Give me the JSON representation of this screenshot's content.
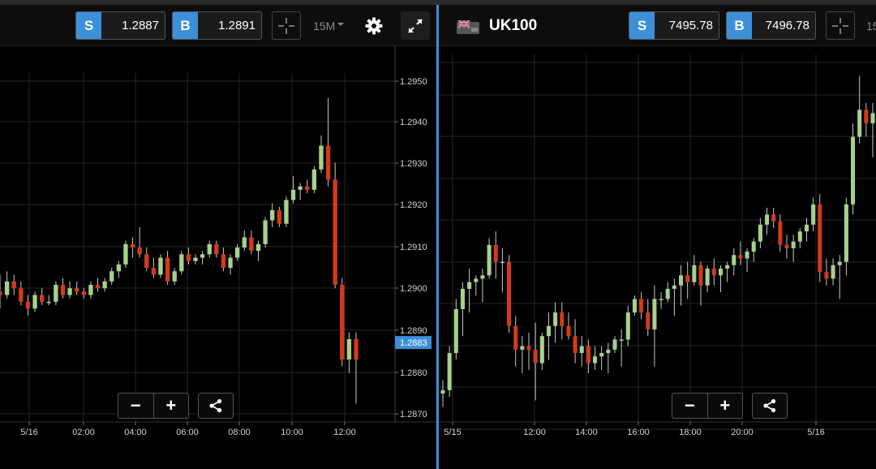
{
  "colors": {
    "up": "#a8d08d",
    "down": "#d23a1a",
    "accent": "#3d8fd8",
    "grid": "#262626",
    "axis_text": "#d0d0d0"
  },
  "left": {
    "quote": {
      "sell_tag": "S",
      "sell": "1.2887",
      "buy_tag": "B",
      "buy": "1.2891"
    },
    "timeframe": "15M",
    "icons": {
      "crosshair": "crosshair-icon",
      "settings": "gear-icon",
      "expand": "expand-icon",
      "share": "share-icon"
    },
    "zoom_out": "−",
    "zoom_in": "+",
    "current_price": "1.2883",
    "chart_data": {
      "type": "candlestick",
      "x_ticks": [
        "5/16",
        "02:00",
        "04:00",
        "06:00",
        "08:00",
        "10:00",
        "12:00"
      ],
      "y_ticks": [
        "1.2950",
        "1.2940",
        "1.2930",
        "1.2920",
        "1.2910",
        "1.2900",
        "1.2890",
        "1.2880",
        "1.2870"
      ],
      "ylim": [
        1.2862,
        1.296
      ],
      "last_price": 1.2883,
      "candles": [
        [
          1.2898,
          1.2903,
          1.2893,
          1.2897
        ],
        [
          1.2897,
          1.2904,
          1.2896,
          1.2901
        ],
        [
          1.2901,
          1.2903,
          1.2897,
          1.2899
        ],
        [
          1.2899,
          1.2901,
          1.2894,
          1.2895
        ],
        [
          1.2895,
          1.2897,
          1.2891,
          1.2893
        ],
        [
          1.2893,
          1.2898,
          1.2892,
          1.2897
        ],
        [
          1.2897,
          1.2899,
          1.2894,
          1.2895
        ],
        [
          1.2895,
          1.2897,
          1.2894,
          1.2895
        ],
        [
          1.2895,
          1.2901,
          1.2894,
          1.29
        ],
        [
          1.29,
          1.2902,
          1.2896,
          1.2897
        ],
        [
          1.2897,
          1.2901,
          1.2896,
          1.2899
        ],
        [
          1.2899,
          1.2901,
          1.2897,
          1.2898
        ],
        [
          1.2898,
          1.2899,
          1.2896,
          1.2897
        ],
        [
          1.2897,
          1.2901,
          1.2896,
          1.29
        ],
        [
          1.29,
          1.2902,
          1.2898,
          1.2899
        ],
        [
          1.2899,
          1.2902,
          1.2898,
          1.2901
        ],
        [
          1.2901,
          1.2905,
          1.29,
          1.2904
        ],
        [
          1.2904,
          1.2907,
          1.2902,
          1.2906
        ],
        [
          1.2906,
          1.2913,
          1.2905,
          1.2912
        ],
        [
          1.2912,
          1.2914,
          1.2908,
          1.2911
        ],
        [
          1.2911,
          1.2917,
          1.2908,
          1.2909
        ],
        [
          1.2909,
          1.2911,
          1.2904,
          1.2905
        ],
        [
          1.2905,
          1.2908,
          1.2902,
          1.2903
        ],
        [
          1.2903,
          1.2909,
          1.2902,
          1.2908
        ],
        [
          1.2908,
          1.291,
          1.29,
          1.2901
        ],
        [
          1.2901,
          1.2905,
          1.29,
          1.2904
        ],
        [
          1.2904,
          1.291,
          1.2903,
          1.2909
        ],
        [
          1.2909,
          1.2911,
          1.2906,
          1.2907
        ],
        [
          1.2907,
          1.2909,
          1.2906,
          1.2908
        ],
        [
          1.2908,
          1.291,
          1.2906,
          1.2909
        ],
        [
          1.2909,
          1.2913,
          1.2908,
          1.2912
        ],
        [
          1.2912,
          1.2913,
          1.2908,
          1.2909
        ],
        [
          1.2909,
          1.2911,
          1.2904,
          1.2905
        ],
        [
          1.2905,
          1.2909,
          1.2903,
          1.2908
        ],
        [
          1.2908,
          1.2912,
          1.2907,
          1.2911
        ],
        [
          1.2911,
          1.2916,
          1.291,
          1.2914
        ],
        [
          1.2914,
          1.2916,
          1.2909,
          1.291
        ],
        [
          1.291,
          1.2913,
          1.2907,
          1.2912
        ],
        [
          1.2912,
          1.292,
          1.2911,
          1.2919
        ],
        [
          1.2919,
          1.2924,
          1.2917,
          1.2922
        ],
        [
          1.2922,
          1.2923,
          1.2917,
          1.2918
        ],
        [
          1.2918,
          1.2926,
          1.2917,
          1.2925
        ],
        [
          1.2925,
          1.2932,
          1.2924,
          1.2928
        ],
        [
          1.2928,
          1.293,
          1.2925,
          1.2929
        ],
        [
          1.2929,
          1.2931,
          1.2927,
          1.2928
        ],
        [
          1.2928,
          1.2935,
          1.2927,
          1.2934
        ],
        [
          1.2934,
          1.2944,
          1.2933,
          1.2941
        ],
        [
          1.2941,
          1.2955,
          1.2929,
          1.2931
        ],
        [
          1.2931,
          1.2936,
          1.2899,
          1.29
        ],
        [
          1.29,
          1.2902,
          1.2876,
          1.2878
        ],
        [
          1.2878,
          1.2886,
          1.2874,
          1.2884
        ],
        [
          1.2884,
          1.2886,
          1.2865,
          1.2878
        ]
      ]
    }
  },
  "right": {
    "symbol": "UK100",
    "flag_icon": "uk-flag-icon",
    "quote": {
      "sell_tag": "S",
      "sell": "7495.78",
      "buy_tag": "B",
      "buy": "7496.78"
    },
    "timeframe_partial": "15",
    "icons": {
      "crosshair": "crosshair-icon",
      "share": "share-icon"
    },
    "zoom_out": "−",
    "zoom_in": "+",
    "chart_data": {
      "type": "candlestick",
      "x_ticks": [
        "5/15",
        "12:00",
        "14:00",
        "16:00",
        "18:00",
        "20:00",
        "5/16"
      ],
      "ylim": [
        7446,
        7550
      ],
      "candles": [
        [
          7452,
          7456,
          7448,
          7453
        ],
        [
          7453,
          7466,
          7451,
          7464
        ],
        [
          7464,
          7480,
          7462,
          7477
        ],
        [
          7477,
          7485,
          7469,
          7483
        ],
        [
          7483,
          7489,
          7476,
          7485
        ],
        [
          7485,
          7487,
          7481,
          7486
        ],
        [
          7486,
          7489,
          7479,
          7487
        ],
        [
          7487,
          7498,
          7486,
          7496
        ],
        [
          7496,
          7500,
          7486,
          7491
        ],
        [
          7491,
          7495,
          7482,
          7491
        ],
        [
          7491,
          7493,
          7470,
          7472
        ],
        [
          7472,
          7475,
          7460,
          7465
        ],
        [
          7465,
          7469,
          7458,
          7466
        ],
        [
          7466,
          7470,
          7459,
          7465
        ],
        [
          7465,
          7473,
          7450,
          7461
        ],
        [
          7461,
          7470,
          7459,
          7469
        ],
        [
          7469,
          7476,
          7462,
          7472
        ],
        [
          7472,
          7479,
          7467,
          7476
        ],
        [
          7476,
          7479,
          7468,
          7472
        ],
        [
          7472,
          7476,
          7468,
          7469
        ],
        [
          7469,
          7474,
          7461,
          7464
        ],
        [
          7464,
          7469,
          7460,
          7466
        ],
        [
          7466,
          7468,
          7458,
          7461
        ],
        [
          7461,
          7466,
          7459,
          7463
        ],
        [
          7463,
          7466,
          7459,
          7464
        ],
        [
          7464,
          7467,
          7458,
          7465
        ],
        [
          7465,
          7469,
          7464,
          7468
        ],
        [
          7468,
          7471,
          7460,
          7468
        ],
        [
          7468,
          7478,
          7466,
          7476
        ],
        [
          7476,
          7481,
          7475,
          7480
        ],
        [
          7480,
          7482,
          7474,
          7476
        ],
        [
          7476,
          7480,
          7469,
          7471
        ],
        [
          7471,
          7484,
          7460,
          7480
        ],
        [
          7480,
          7482,
          7477,
          7480
        ],
        [
          7480,
          7485,
          7479,
          7483
        ],
        [
          7483,
          7486,
          7475,
          7484
        ],
        [
          7484,
          7490,
          7478,
          7487
        ],
        [
          7487,
          7491,
          7480,
          7485
        ],
        [
          7485,
          7493,
          7484,
          7490
        ],
        [
          7490,
          7491,
          7478,
          7484
        ],
        [
          7484,
          7490,
          7482,
          7489
        ],
        [
          7489,
          7492,
          7484,
          7487
        ],
        [
          7487,
          7490,
          7482,
          7489
        ],
        [
          7489,
          7491,
          7485,
          7490
        ],
        [
          7490,
          7495,
          7487,
          7493
        ],
        [
          7493,
          7497,
          7490,
          7492
        ],
        [
          7492,
          7495,
          7488,
          7494
        ],
        [
          7494,
          7498,
          7491,
          7497
        ],
        [
          7497,
          7504,
          7495,
          7502
        ],
        [
          7502,
          7507,
          7499,
          7505
        ],
        [
          7505,
          7507,
          7501,
          7503
        ],
        [
          7503,
          7505,
          7494,
          7496
        ],
        [
          7496,
          7499,
          7492,
          7495
        ],
        [
          7495,
          7499,
          7491,
          7497
        ],
        [
          7497,
          7501,
          7495,
          7500
        ],
        [
          7500,
          7504,
          7497,
          7502
        ],
        [
          7502,
          7510,
          7500,
          7508
        ],
        [
          7508,
          7511,
          7485,
          7488
        ],
        [
          7488,
          7492,
          7484,
          7486
        ],
        [
          7486,
          7492,
          7484,
          7490
        ],
        [
          7490,
          7493,
          7480,
          7491
        ],
        [
          7491,
          7510,
          7487,
          7508
        ],
        [
          7508,
          7532,
          7505,
          7528
        ],
        [
          7528,
          7546,
          7526,
          7536
        ],
        [
          7536,
          7538,
          7528,
          7532
        ],
        [
          7532,
          7538,
          7522,
          7535
        ]
      ]
    }
  }
}
